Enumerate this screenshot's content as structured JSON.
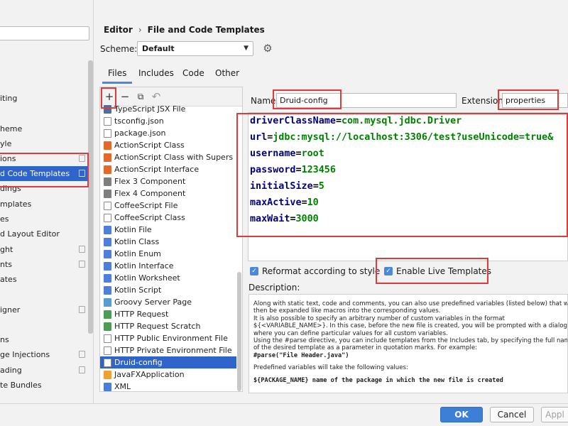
{
  "sidebar": {
    "items": [
      {
        "label": "iting"
      },
      {
        "label": "heme"
      },
      {
        "label": "yle"
      },
      {
        "label": "ions"
      },
      {
        "label": "d Code Templates"
      },
      {
        "label": "dings"
      },
      {
        "label": "mplates"
      },
      {
        "label": "es"
      },
      {
        "label": "d Layout Editor"
      },
      {
        "label": "ght"
      },
      {
        "label": "nts"
      },
      {
        "label": "ates"
      },
      {
        "label": "igner"
      },
      {
        "label": "ns"
      },
      {
        "label": "ge Injections"
      },
      {
        "label": "ading"
      },
      {
        "label": "te Bundles"
      }
    ]
  },
  "header": {
    "breadcrumb": [
      "Editor",
      "File and Code Templates"
    ],
    "scheme_label": "Scheme:",
    "scheme_value": "Default"
  },
  "tabs": [
    {
      "label": "Files"
    },
    {
      "label": "Includes"
    },
    {
      "label": "Code"
    },
    {
      "label": "Other"
    }
  ],
  "toolbar": {
    "add": "+",
    "remove": "−",
    "copy": "⧉",
    "reset": "↶"
  },
  "templates": [
    {
      "label": "TypeScript JSX File"
    },
    {
      "label": "tsconfig.json"
    },
    {
      "label": "package.json"
    },
    {
      "label": "ActionScript Class"
    },
    {
      "label": "ActionScript Class with Supers"
    },
    {
      "label": "ActionScript Interface"
    },
    {
      "label": "Flex 3 Component"
    },
    {
      "label": "Flex 4 Component"
    },
    {
      "label": "CoffeeScript File"
    },
    {
      "label": "CoffeeScript Class"
    },
    {
      "label": "Kotlin File"
    },
    {
      "label": "Kotlin Class"
    },
    {
      "label": "Kotlin Enum"
    },
    {
      "label": "Kotlin Interface"
    },
    {
      "label": "Kotlin Worksheet"
    },
    {
      "label": "Kotlin Script"
    },
    {
      "label": "Groovy Server Page"
    },
    {
      "label": "HTTP Request"
    },
    {
      "label": "HTTP Request Scratch"
    },
    {
      "label": "HTTP Public Environment File"
    },
    {
      "label": "HTTP Private Environment File"
    },
    {
      "label": "Druid-config"
    },
    {
      "label": "JavaFXApplication"
    },
    {
      "label": "XML"
    }
  ],
  "form": {
    "name_label": "Name:",
    "name_value": "Druid-config",
    "extension_label": "Extension:",
    "extension_value": "properties"
  },
  "code": [
    {
      "key": "driverClassName",
      "eq": "=",
      "value": "com.mysql.jdbc.Driver"
    },
    {
      "key": "url",
      "eq": "=",
      "value": "jdbc:mysql://localhost:3306/test?useUnicode=true&"
    },
    {
      "key": "username",
      "eq": "=",
      "value": "root"
    },
    {
      "key": "password",
      "eq": "=",
      "value": "123456"
    },
    {
      "key": "initialSize",
      "eq": "=",
      "value": "5"
    },
    {
      "key": "maxActive",
      "eq": "=",
      "value": "10"
    },
    {
      "key": "maxWait",
      "eq": "=",
      "value": "3000"
    }
  ],
  "options": {
    "reformat_label": "Reformat according to style",
    "live_templates_label": "Enable Live Templates"
  },
  "description": {
    "label": "Description:",
    "lines": [
      "Along with static text, code and comments, you can also use predefined variables (listed below) that will",
      "then be expanded like macros into the corresponding values.",
      "It is also possible to specify an arbitrary number of custom variables in the format",
      "${<VARIABLE_NAME>}. In this case, before the new file is created, you will be prompted with a dialog",
      "where you can define particular values for all custom variables.",
      "Using the #parse directive, you can include templates from the Includes tab, by specifying the full name",
      "of the desired template as a parameter in quotation marks. For example:",
      "#parse(\"File Header.java\")",
      "Predefined variables will take the following values:",
      "${PACKAGE_NAME}            name of the package in which the new file is created"
    ]
  },
  "footer": {
    "ok": "OK",
    "cancel": "Cancel",
    "apply": "Appl"
  }
}
